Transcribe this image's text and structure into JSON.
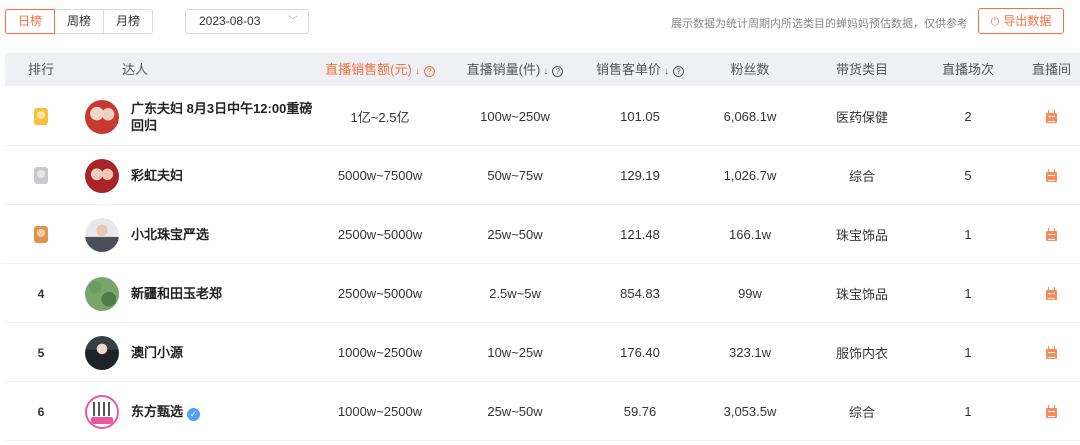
{
  "toolbar": {
    "tabs": [
      {
        "label": "日榜",
        "active": true
      },
      {
        "label": "周榜",
        "active": false
      },
      {
        "label": "月榜",
        "active": false
      }
    ],
    "date_value": "2023-08-03",
    "notice": "展示数据为统计周期内所选类目的蝉妈妈预估数据，仅供参考",
    "export_label": "导出数据",
    "accent_color": "#fa6e3c"
  },
  "table": {
    "headers": {
      "rank": "排行",
      "influencer": "达人",
      "sales_amount": "直播销售额(元)",
      "sales_volume": "直播销量(件)",
      "unit_price": "销售客单价",
      "followers": "粉丝数",
      "category": "带货类目",
      "sessions": "直播场次",
      "live_room": "直播间"
    },
    "rows": [
      {
        "rank": "1",
        "medal": "gold",
        "avatar": "avatar-couple-red",
        "name": "广东夫妇 8月3日中午12:00重磅回归",
        "verified": false,
        "sales_amount": "1亿~2.5亿",
        "sales_volume": "100w~250w",
        "unit_price": "101.05",
        "followers": "6,068.1w",
        "category": "医药保健",
        "sessions": "2"
      },
      {
        "rank": "2",
        "medal": "silver",
        "avatar": "avatar-couple-rainbow",
        "name": "彩虹夫妇",
        "verified": false,
        "sales_amount": "5000w~7500w",
        "sales_volume": "50w~75w",
        "unit_price": "129.19",
        "followers": "1,026.7w",
        "category": "综合",
        "sessions": "5"
      },
      {
        "rank": "3",
        "medal": "bronze",
        "avatar": "avatar-man-suit",
        "name": "小北珠宝严选",
        "verified": false,
        "sales_amount": "2500w~5000w",
        "sales_volume": "25w~50w",
        "unit_price": "121.48",
        "followers": "166.1w",
        "category": "珠宝饰品",
        "sessions": "1"
      },
      {
        "rank": "4",
        "medal": "",
        "avatar": "avatar-jade",
        "name": "新疆和田玉老郑",
        "verified": false,
        "sales_amount": "2500w~5000w",
        "sales_volume": "2.5w~5w",
        "unit_price": "854.83",
        "followers": "99w",
        "category": "珠宝饰品",
        "sessions": "1"
      },
      {
        "rank": "5",
        "medal": "",
        "avatar": "avatar-woman",
        "name": "澳门小源",
        "verified": false,
        "sales_amount": "1000w~2500w",
        "sales_volume": "10w~25w",
        "unit_price": "176.40",
        "followers": "323.1w",
        "category": "服饰内衣",
        "sessions": "1"
      },
      {
        "rank": "6",
        "medal": "",
        "avatar": "avatar-east-live",
        "name": "东方甄选",
        "verified": true,
        "sales_amount": "1000w~2500w",
        "sales_volume": "25w~50w",
        "unit_price": "59.76",
        "followers": "3,053.5w",
        "category": "综合",
        "sessions": "1"
      }
    ]
  }
}
